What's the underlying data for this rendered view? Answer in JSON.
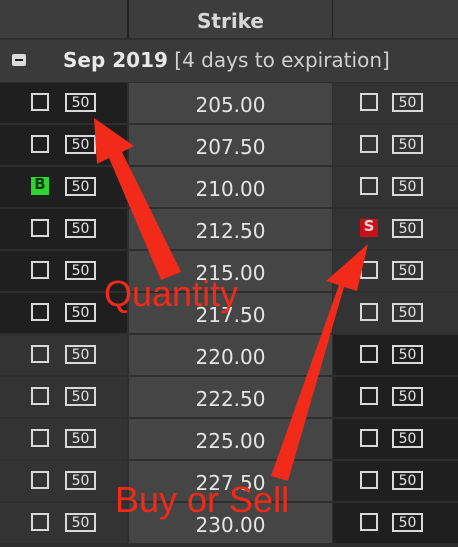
{
  "header": {
    "title": "Strike"
  },
  "expiration": {
    "month": "Sep 2019",
    "detail": "[4 days to expiration]"
  },
  "rows": [
    {
      "strike": "205.00",
      "call": {
        "qty": "50",
        "action": ""
      },
      "put": {
        "qty": "50",
        "action": ""
      }
    },
    {
      "strike": "207.50",
      "call": {
        "qty": "50",
        "action": ""
      },
      "put": {
        "qty": "50",
        "action": ""
      }
    },
    {
      "strike": "210.00",
      "call": {
        "qty": "50",
        "action": "B"
      },
      "put": {
        "qty": "50",
        "action": ""
      }
    },
    {
      "strike": "212.50",
      "call": {
        "qty": "50",
        "action": ""
      },
      "put": {
        "qty": "50",
        "action": "S"
      }
    },
    {
      "strike": "215.00",
      "call": {
        "qty": "50",
        "action": ""
      },
      "put": {
        "qty": "50",
        "action": ""
      }
    },
    {
      "strike": "217.50",
      "call": {
        "qty": "50",
        "action": ""
      },
      "put": {
        "qty": "50",
        "action": ""
      }
    },
    {
      "strike": "220.00",
      "call": {
        "qty": "50",
        "action": ""
      },
      "put": {
        "qty": "50",
        "action": ""
      }
    },
    {
      "strike": "222.50",
      "call": {
        "qty": "50",
        "action": ""
      },
      "put": {
        "qty": "50",
        "action": ""
      }
    },
    {
      "strike": "225.00",
      "call": {
        "qty": "50",
        "action": ""
      },
      "put": {
        "qty": "50",
        "action": ""
      }
    },
    {
      "strike": "227.50",
      "call": {
        "qty": "50",
        "action": ""
      },
      "put": {
        "qty": "50",
        "action": ""
      }
    },
    {
      "strike": "230.00",
      "call": {
        "qty": "50",
        "action": ""
      },
      "put": {
        "qty": "50",
        "action": ""
      }
    }
  ],
  "annotations": {
    "quantity": "Quantity",
    "buy_or_sell": "Buy or Sell"
  },
  "colors": {
    "buy": "#2fd52f",
    "sell": "#c8101a",
    "arrow": "#f12a1a"
  }
}
